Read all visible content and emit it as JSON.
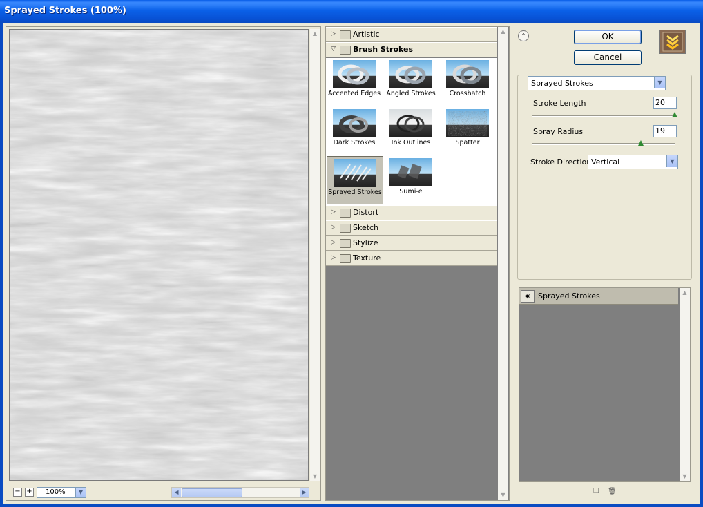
{
  "window": {
    "title": "Sprayed Strokes (100%)"
  },
  "preview": {
    "zoom_value": "100%",
    "zoom_out_label": "−",
    "zoom_in_label": "+"
  },
  "gallery": {
    "categories_before": [
      {
        "label": "Artistic",
        "open": false
      }
    ],
    "open_category": {
      "label": "Brush Strokes"
    },
    "filters": [
      {
        "label": "Accented Edges",
        "selected": false
      },
      {
        "label": "Angled Strokes",
        "selected": false
      },
      {
        "label": "Crosshatch",
        "selected": false
      },
      {
        "label": "Dark Strokes",
        "selected": false
      },
      {
        "label": "Ink Outlines",
        "selected": false
      },
      {
        "label": "Spatter",
        "selected": false
      },
      {
        "label": "Sprayed Strokes",
        "selected": true
      },
      {
        "label": "Sumi-e",
        "selected": false
      }
    ],
    "categories_after": [
      {
        "label": "Distort"
      },
      {
        "label": "Sketch"
      },
      {
        "label": "Stylize"
      },
      {
        "label": "Texture"
      }
    ]
  },
  "buttons": {
    "ok": "OK",
    "cancel": "Cancel"
  },
  "settings": {
    "filter_select": "Sprayed Strokes",
    "stroke_length": {
      "label": "Stroke Length",
      "value": "20",
      "level": 1.0
    },
    "spray_radius": {
      "label": "Spray Radius",
      "value": "19",
      "level": 0.76
    },
    "stroke_direction": {
      "label": "Stroke Direction:",
      "value": "Vertical"
    }
  },
  "layers": [
    {
      "name": "Sprayed Strokes",
      "visible": true
    }
  ],
  "icons": {
    "collapse": "double-chevron-up-icon",
    "visibility": "eye-icon",
    "new_layer": "new-layer-icon",
    "delete_layer": "trash-icon"
  },
  "colors": {
    "title_bar": "#0a5ee8",
    "panel_bg": "#ece9d8",
    "gallery_bg": "#7f7f7f",
    "slider_knob": "#2f8a32"
  }
}
